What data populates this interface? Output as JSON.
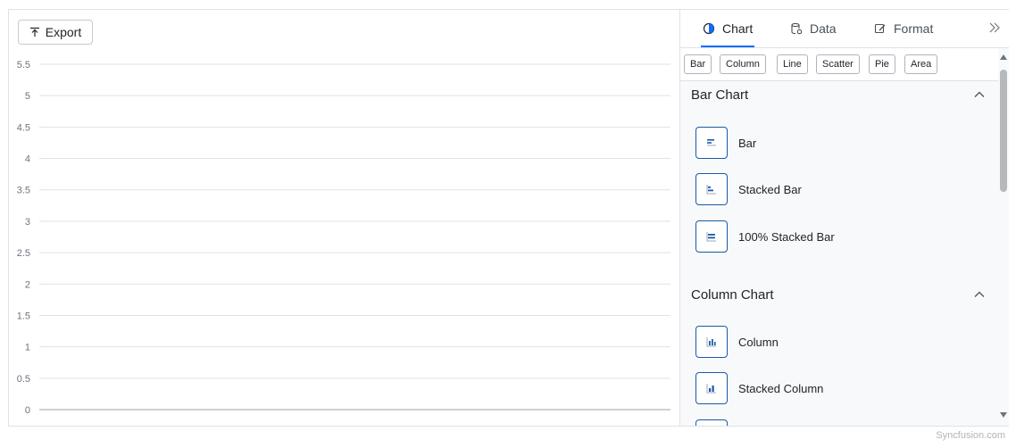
{
  "toolbar": {
    "export_label": "Export"
  },
  "chart_data": {
    "type": "line",
    "ylim": [
      0,
      5.5
    ],
    "yticks": [
      "0",
      "0.5",
      "1",
      "1.5",
      "2",
      "2.5",
      "3",
      "3.5",
      "4",
      "4.5",
      "5",
      "5.5"
    ],
    "series": [],
    "grid": true
  },
  "panel": {
    "tabs": [
      {
        "label": "Chart",
        "icon": "pie-chart-icon",
        "active": true
      },
      {
        "label": "Data",
        "icon": "database-icon",
        "active": false
      },
      {
        "label": "Format",
        "icon": "format-brush-icon",
        "active": false
      }
    ],
    "filters": [
      "Bar",
      "Column",
      "Line",
      "Scatter",
      "Pie",
      "Area"
    ],
    "sections": [
      {
        "title": "Bar Chart",
        "items": [
          "Bar",
          "Stacked Bar",
          "100% Stacked Bar"
        ]
      },
      {
        "title": "Column Chart",
        "items": [
          "Column",
          "Stacked Column"
        ]
      }
    ]
  },
  "watermark": "Syncfusion.com",
  "colors": {
    "accent": "#0d6efd",
    "icon_border": "#1a5aa6",
    "grid": "#dee2e6"
  }
}
